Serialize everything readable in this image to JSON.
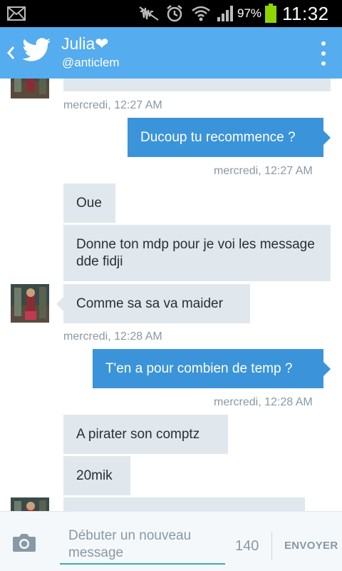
{
  "status_bar": {
    "battery_percent": "97%",
    "time": "11:32",
    "icons": [
      "mail-icon",
      "mute-icon",
      "alarm-icon",
      "wifi-icon",
      "signal-icon",
      "battery-icon"
    ]
  },
  "header": {
    "name": "Julia❤",
    "handle": "@anticlem",
    "back_icon": "chevron-left-icon",
    "app_icon": "twitter-bird-icon",
    "menu_icon": "overflow-menu-icon"
  },
  "messages": [
    {
      "direction": "in",
      "text": ""
    },
    {
      "type": "timestamp",
      "direction": "in",
      "text": "mercredi, 12:27 AM"
    },
    {
      "direction": "out",
      "text": "Ducoup tu recommence ?"
    },
    {
      "type": "timestamp",
      "direction": "out",
      "text": "mercredi, 12:27 AM"
    },
    {
      "direction": "in",
      "text": "Oue"
    },
    {
      "direction": "in",
      "text": "Donne ton mdp pour je voi les message dde fidji"
    },
    {
      "direction": "in",
      "text": "Comme sa sa va maider"
    },
    {
      "type": "timestamp",
      "direction": "in",
      "text": "mercredi, 12:28 AM"
    },
    {
      "direction": "out",
      "text": "T'en a pour combien de temp ?"
    },
    {
      "type": "timestamp",
      "direction": "out",
      "text": "mercredi, 12:28 AM"
    },
    {
      "direction": "in",
      "text": "A pirater son comptz"
    },
    {
      "direction": "in",
      "text": "20mik"
    },
    {
      "direction": "in",
      "text": ""
    }
  ],
  "compose": {
    "placeholder": "Débuter un nouveau message",
    "char_count": "140",
    "send_label": "ENVOYER",
    "camera_icon": "camera-icon"
  },
  "colors": {
    "action_bar": "#55acee",
    "outgoing_bubble": "#3b94d9",
    "incoming_bubble": "#e1e8ed",
    "timestamp_text": "#8899a6",
    "input_underline": "#3ba9b6"
  }
}
